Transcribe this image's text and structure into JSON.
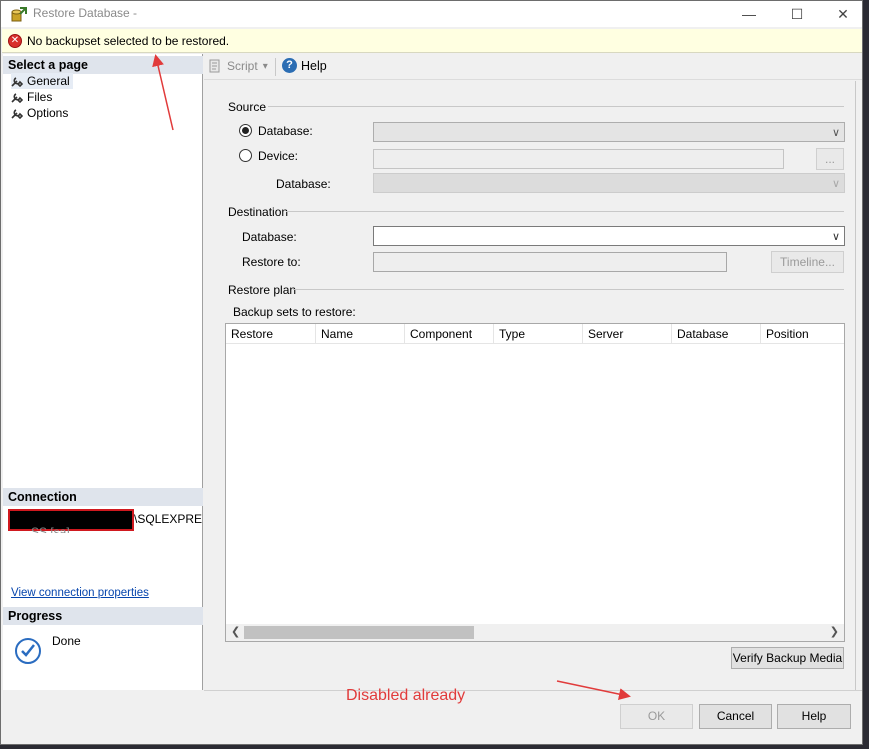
{
  "window": {
    "title": "Restore Database -",
    "controls": {
      "minimize": "—",
      "maximize": "☐",
      "close": "✕"
    }
  },
  "infobar": {
    "message": "No backupset selected to be restored.",
    "icon": "error-icon",
    "error_symbol": "✕"
  },
  "left_pane": {
    "select_page_header": "Select a page",
    "pages": [
      {
        "label": "General",
        "icon": "wrench-icon",
        "selected": true
      },
      {
        "label": "Files",
        "icon": "wrench-icon",
        "selected": false
      },
      {
        "label": "Options",
        "icon": "wrench-icon",
        "selected": false
      }
    ],
    "connection_header": "Connection",
    "connection_server_suffix": "\\SQLEXPRE",
    "connection_line2": "SS [sa]",
    "view_connection_link": "View connection properties",
    "progress_header": "Progress",
    "progress_status": "Done"
  },
  "toolbar": {
    "script_label": "Script",
    "script_dropdown": "▾",
    "help_label": "Help",
    "help_symbol": "?"
  },
  "source": {
    "group_label": "Source",
    "database_radio_label": "Database:",
    "device_radio_label": "Device:",
    "selected": "Database",
    "device_browse_label": "...",
    "database_sub_label": "Database:"
  },
  "destination": {
    "group_label": "Destination",
    "database_label": "Database:",
    "restore_to_label": "Restore to:",
    "timeline_button": "Timeline..."
  },
  "restore_plan": {
    "group_label": "Restore plan",
    "backup_sets_label": "Backup sets to restore:",
    "columns": [
      "Restore",
      "Name",
      "Component",
      "Type",
      "Server",
      "Database",
      "Position"
    ],
    "rows": []
  },
  "verify_button": "Verify Backup Media",
  "footer": {
    "ok_label": "OK",
    "ok_enabled": false,
    "cancel_label": "Cancel",
    "help_label": "Help"
  },
  "annotation": {
    "text": "Disabled already",
    "color": "#e13b3b"
  },
  "colors": {
    "infobar_bg": "#ffffe1",
    "header_bg": "#dfe4ec",
    "link": "#0645ad",
    "redaction_border": "#d0191f"
  }
}
